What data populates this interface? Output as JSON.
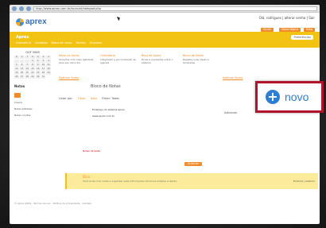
{
  "browser": {
    "url": "http://www.aprex.com.br/account/notepad.php"
  },
  "header": {
    "logo_text": "aprex",
    "user_text": "Olá, rodrigues | alterar senha | Sair",
    "buttons": [
      "Ajuda",
      "Novo tópico",
      "Blog"
    ]
  },
  "yellow_bar": {
    "page_heading": "Aprex",
    "submenu": [
      "Calendário",
      "Contatos",
      "Bloco de notas",
      "Tarefas",
      "Arquivos"
    ],
    "prefs_button": "Preferências"
  },
  "calendar": {
    "title": "OUT 2009",
    "weekdays": [
      "D",
      "S",
      "T",
      "Q",
      "Q",
      "S",
      "S"
    ],
    "days": [
      "",
      "",
      "",
      "1",
      "2",
      "3",
      "4",
      "5",
      "6",
      "7",
      "8",
      "9",
      "10",
      "11",
      "12",
      "13",
      "14",
      "15",
      "16",
      "17",
      "18",
      "19",
      "20",
      "21",
      "22",
      "23",
      "24",
      "25",
      "26",
      "27",
      "28",
      "29",
      "30",
      "31"
    ]
  },
  "news": {
    "items": [
      {
        "title": "Novo no Aprex",
        "text": "Soluções com mais agilidade para seu dia a dia"
      },
      {
        "title": "Calendário",
        "text": "Integração e sincronização de agenda"
      },
      {
        "title": "Blog do Aprex",
        "text": "Dicas e novidades sobre o sistema"
      },
      {
        "title": "Bloco de Notas",
        "text": "Registre suas ideias e lembretes"
      }
    ],
    "all_link_left": "Notícias Aprex",
    "all_link_right": "Notícias Aprex"
  },
  "sidebar": {
    "title": "Notas",
    "links": [
      "Lixeira",
      "Notas editadas",
      "Notas ocultas"
    ]
  },
  "notes": {
    "title": "Bloco de Notas",
    "filter_label": "Listar por:",
    "filter_links": [
      "Título",
      "Data"
    ],
    "filter_mode": "Filtrar: Todas",
    "entries": [
      "Endereço do sistema aprex",
      "www.aprex.com.br"
    ],
    "extra": "Notas de teste",
    "side_link": "Adicionar"
  },
  "page_button": "Anterior",
  "tip": {
    "title": "Dica",
    "text": "Você pode criar notas e organizar suas informações de forma simples e rápida.",
    "nav": "Próxima | Anterior"
  },
  "footer": "© Aprex 2009 · Termos de uso · Política de privacidade · Contato",
  "callout": {
    "label": "novo",
    "icon": "plus-circle-icon",
    "border_color": "#b2132a",
    "accent": "#2e7fd1"
  }
}
